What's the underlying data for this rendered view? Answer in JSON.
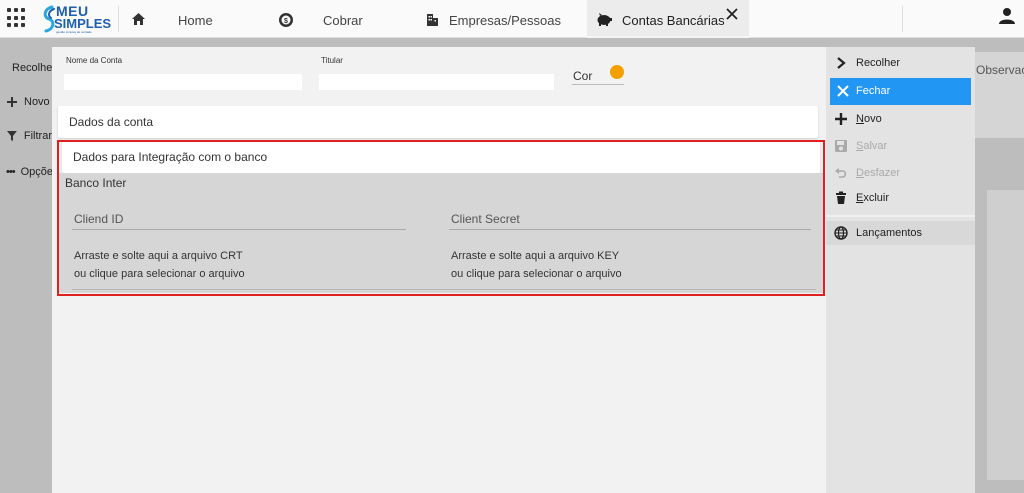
{
  "logo": {
    "line1": "MEU",
    "line2": "SIMPLES",
    "tagline": "gestão simples de verdade"
  },
  "tabs": [
    {
      "label": "Home"
    },
    {
      "label": "Cobrar"
    },
    {
      "label": "Empresas/Pessoas"
    },
    {
      "label": "Contas Bancárias"
    }
  ],
  "left_sidebar": {
    "items": [
      {
        "label": "Recolher"
      },
      {
        "label": "Novo"
      },
      {
        "label": "Filtrar"
      },
      {
        "label": "Opções"
      }
    ]
  },
  "background_right": {
    "label": "Observações"
  },
  "form": {
    "account_name_label": "Nome da Conta",
    "account_name_value": "",
    "holder_label": "Titular",
    "holder_value": "",
    "color_label": "Cor",
    "color_value": "#f5a000"
  },
  "sections": {
    "account_data": "Dados da conta",
    "integration": "Dados para Integração com o banco"
  },
  "integration": {
    "bank_name": "Banco Inter",
    "client_id_label": "Cliend ID",
    "client_secret_label": "Client Secret",
    "crt_drop_line1": "Arraste e solte aqui a arquivo CRT",
    "crt_drop_line2": "ou clique para selecionar o arquivo",
    "key_drop_line1": "Arraste e solte aqui a arquivo KEY",
    "key_drop_line2": "ou clique para selecionar o arquivo"
  },
  "actions": {
    "collapse": "Recolher",
    "close": "Fechar",
    "new_prefix": "N",
    "new_rest": "ovo",
    "save_prefix": "S",
    "save_rest": "alvar",
    "undo_prefix": "D",
    "undo_rest": "esfazer",
    "delete_prefix": "E",
    "delete_rest": "xcluir",
    "entries": "Lançamentos"
  },
  "colors": {
    "primary": "#2196f3",
    "highlight": "#e02020",
    "brand": "#1f5fb0"
  }
}
